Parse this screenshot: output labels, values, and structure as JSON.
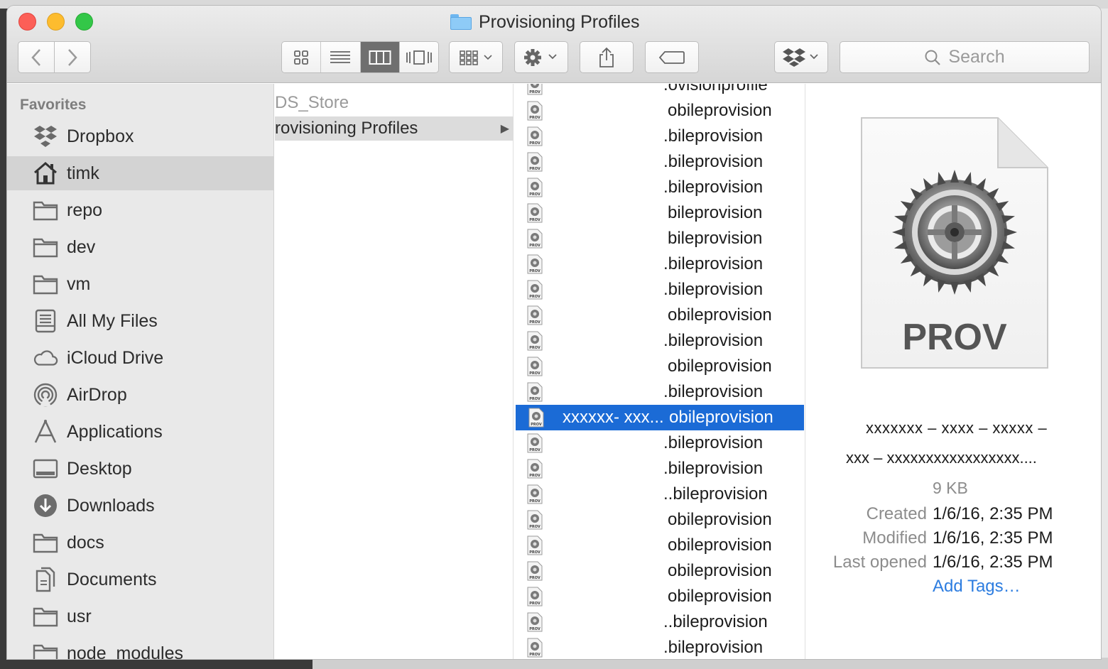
{
  "window": {
    "title": "Provisioning Profiles"
  },
  "toolbar": {
    "back_icon": "chevron-left-icon",
    "forward_icon": "chevron-right-icon",
    "view_modes": [
      "icon-view",
      "list-view",
      "column-view",
      "cover-flow-view"
    ],
    "active_view": "column-view",
    "search_placeholder": "Search"
  },
  "sidebar": {
    "heading": "Favorites",
    "items": [
      {
        "label": "Dropbox",
        "icon": "dropbox-icon",
        "selected": false
      },
      {
        "label": "timk",
        "icon": "home-icon",
        "selected": true
      },
      {
        "label": "repo",
        "icon": "folder-icon",
        "selected": false
      },
      {
        "label": "dev",
        "icon": "folder-icon",
        "selected": false
      },
      {
        "label": "vm",
        "icon": "folder-icon",
        "selected": false
      },
      {
        "label": "All My Files",
        "icon": "all-files-icon",
        "selected": false
      },
      {
        "label": "iCloud Drive",
        "icon": "cloud-icon",
        "selected": false
      },
      {
        "label": "AirDrop",
        "icon": "airdrop-icon",
        "selected": false
      },
      {
        "label": "Applications",
        "icon": "applications-icon",
        "selected": false
      },
      {
        "label": "Desktop",
        "icon": "desktop-icon",
        "selected": false
      },
      {
        "label": "Downloads",
        "icon": "downloads-icon",
        "selected": false
      },
      {
        "label": "docs",
        "icon": "folder-icon",
        "selected": false
      },
      {
        "label": "Documents",
        "icon": "documents-icon",
        "selected": false
      },
      {
        "label": "usr",
        "icon": "folder-icon",
        "selected": false
      },
      {
        "label": "node_modules",
        "icon": "folder-icon",
        "selected": false
      }
    ]
  },
  "column1": {
    "items": [
      {
        "label": "DS_Store",
        "dim": true
      },
      {
        "label": "rovisioning Profiles",
        "selected": true
      }
    ]
  },
  "column2": {
    "selected_prefix": "xxxxxx- xxx...",
    "files": [
      ".ovisionprofile",
      "obileprovision",
      ".bileprovision",
      ".bileprovision",
      ".bileprovision",
      "bileprovision",
      "bileprovision",
      ".bileprovision",
      ".bileprovision",
      "obileprovision",
      ".bileprovision",
      "obileprovision",
      ".bileprovision",
      "obileprovision",
      ".bileprovision",
      ".bileprovision",
      "..bileprovision",
      "obileprovision",
      "obileprovision",
      "obileprovision",
      "obileprovision",
      "..bileprovision",
      ".bileprovision"
    ],
    "selected_index": 13
  },
  "preview": {
    "icon_label": "PROV",
    "name_line1": "xxxxxxx – xxxx – xxxxx –",
    "name_line2": "xxx – xxxxxxxxxxxxxxxxx....",
    "size": "9 KB",
    "created_label": "Created",
    "created_value": "1/6/16, 2:35 PM",
    "modified_label": "Modified",
    "modified_value": "1/6/16, 2:35 PM",
    "opened_label": "Last opened",
    "opened_value": "1/6/16, 2:35 PM",
    "add_tags": "Add Tags…"
  },
  "colors": {
    "selection": "#1b6bd6",
    "link": "#2d7de0",
    "sidebar_bg": "#e9e9e9"
  }
}
